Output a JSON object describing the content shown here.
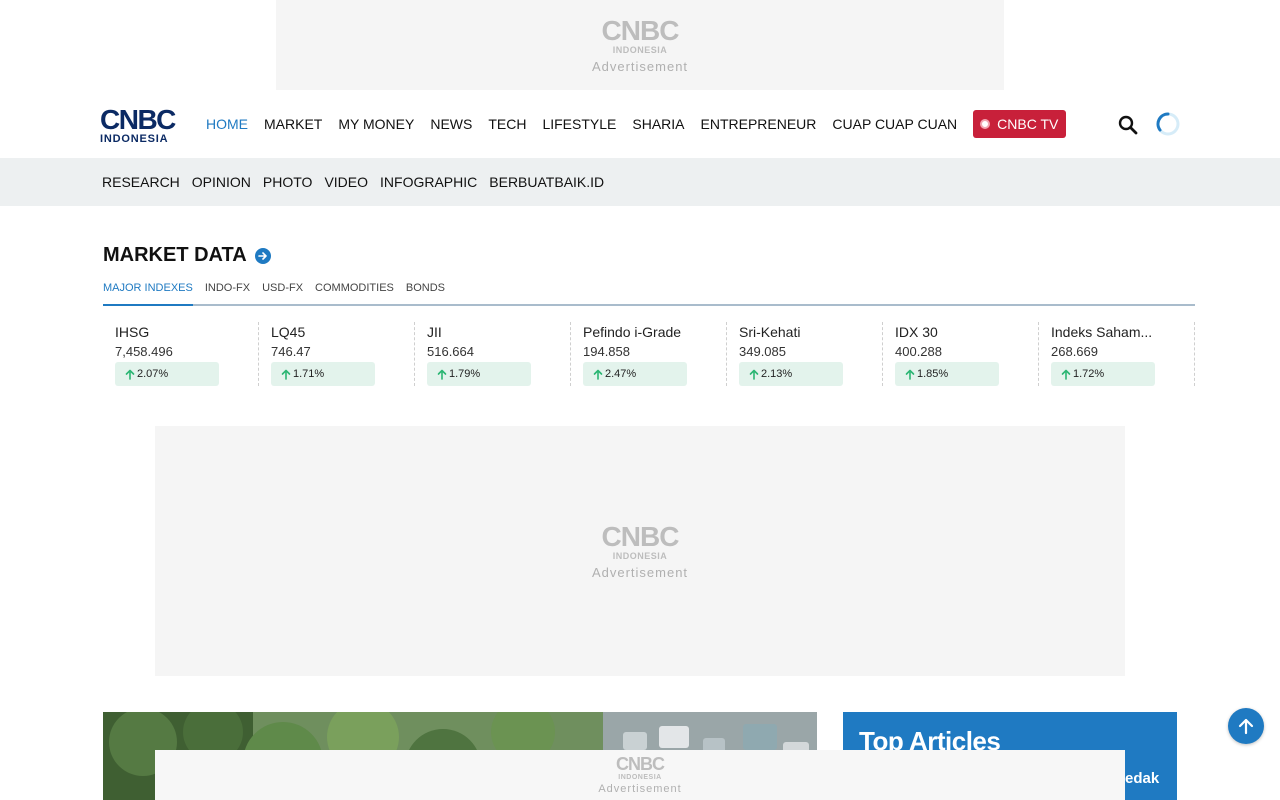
{
  "ads": {
    "top": {
      "logo_main": "CNBC",
      "logo_sub": "INDONESIA",
      "label": "Advertisement"
    },
    "middle": {
      "logo_main": "CNBC",
      "logo_sub": "INDONESIA",
      "label": "Advertisement"
    },
    "bottom": {
      "logo_main": "CNBC",
      "logo_sub": "INDONESIA",
      "label": "Advertisement"
    }
  },
  "header": {
    "logo_main": "CNBC",
    "logo_sub": "INDONESIA",
    "nav": [
      "HOME",
      "MARKET",
      "MY MONEY",
      "NEWS",
      "TECH",
      "LIFESTYLE",
      "SHARIA",
      "ENTREPRENEUR",
      "CUAP CUAP CUAN"
    ],
    "active_nav": "HOME",
    "cnbc_tv_label": "CNBC TV",
    "icons": {
      "search": "search-icon",
      "loading": "loading-spinner-icon"
    }
  },
  "sub_nav": [
    "RESEARCH",
    "OPINION",
    "PHOTO",
    "VIDEO",
    "INFOGRAPHIC",
    "BERBUATBAIK.ID"
  ],
  "market_data": {
    "title": "MARKET DATA",
    "tabs": [
      "MAJOR INDEXES",
      "INDO-FX",
      "USD-FX",
      "COMMODITIES",
      "BONDS"
    ],
    "active_tab": "MAJOR INDEXES",
    "indexes": [
      {
        "name": "IHSG",
        "value": "7,458.496",
        "change": "2.07%"
      },
      {
        "name": "LQ45",
        "value": "746.47",
        "change": "1.71%"
      },
      {
        "name": "JII",
        "value": "516.664",
        "change": "1.79%"
      },
      {
        "name": "Pefindo i-Grade",
        "value": "194.858",
        "change": "2.47%"
      },
      {
        "name": "Sri-Kehati",
        "value": "349.085",
        "change": "2.13%"
      },
      {
        "name": "IDX 30",
        "value": "400.288",
        "change": "1.85%"
      },
      {
        "name": "Indeks Saham...",
        "value": "268.669",
        "change": "1.72%"
      }
    ]
  },
  "top_articles": {
    "title": "Top Articles",
    "peek_text": "edak"
  },
  "colors": {
    "accent": "#1f7ac2",
    "brand_navy": "#0b2a64",
    "tv_red": "#c8203a",
    "up_green": "#2bb673",
    "up_bg": "#e3f3ec"
  }
}
